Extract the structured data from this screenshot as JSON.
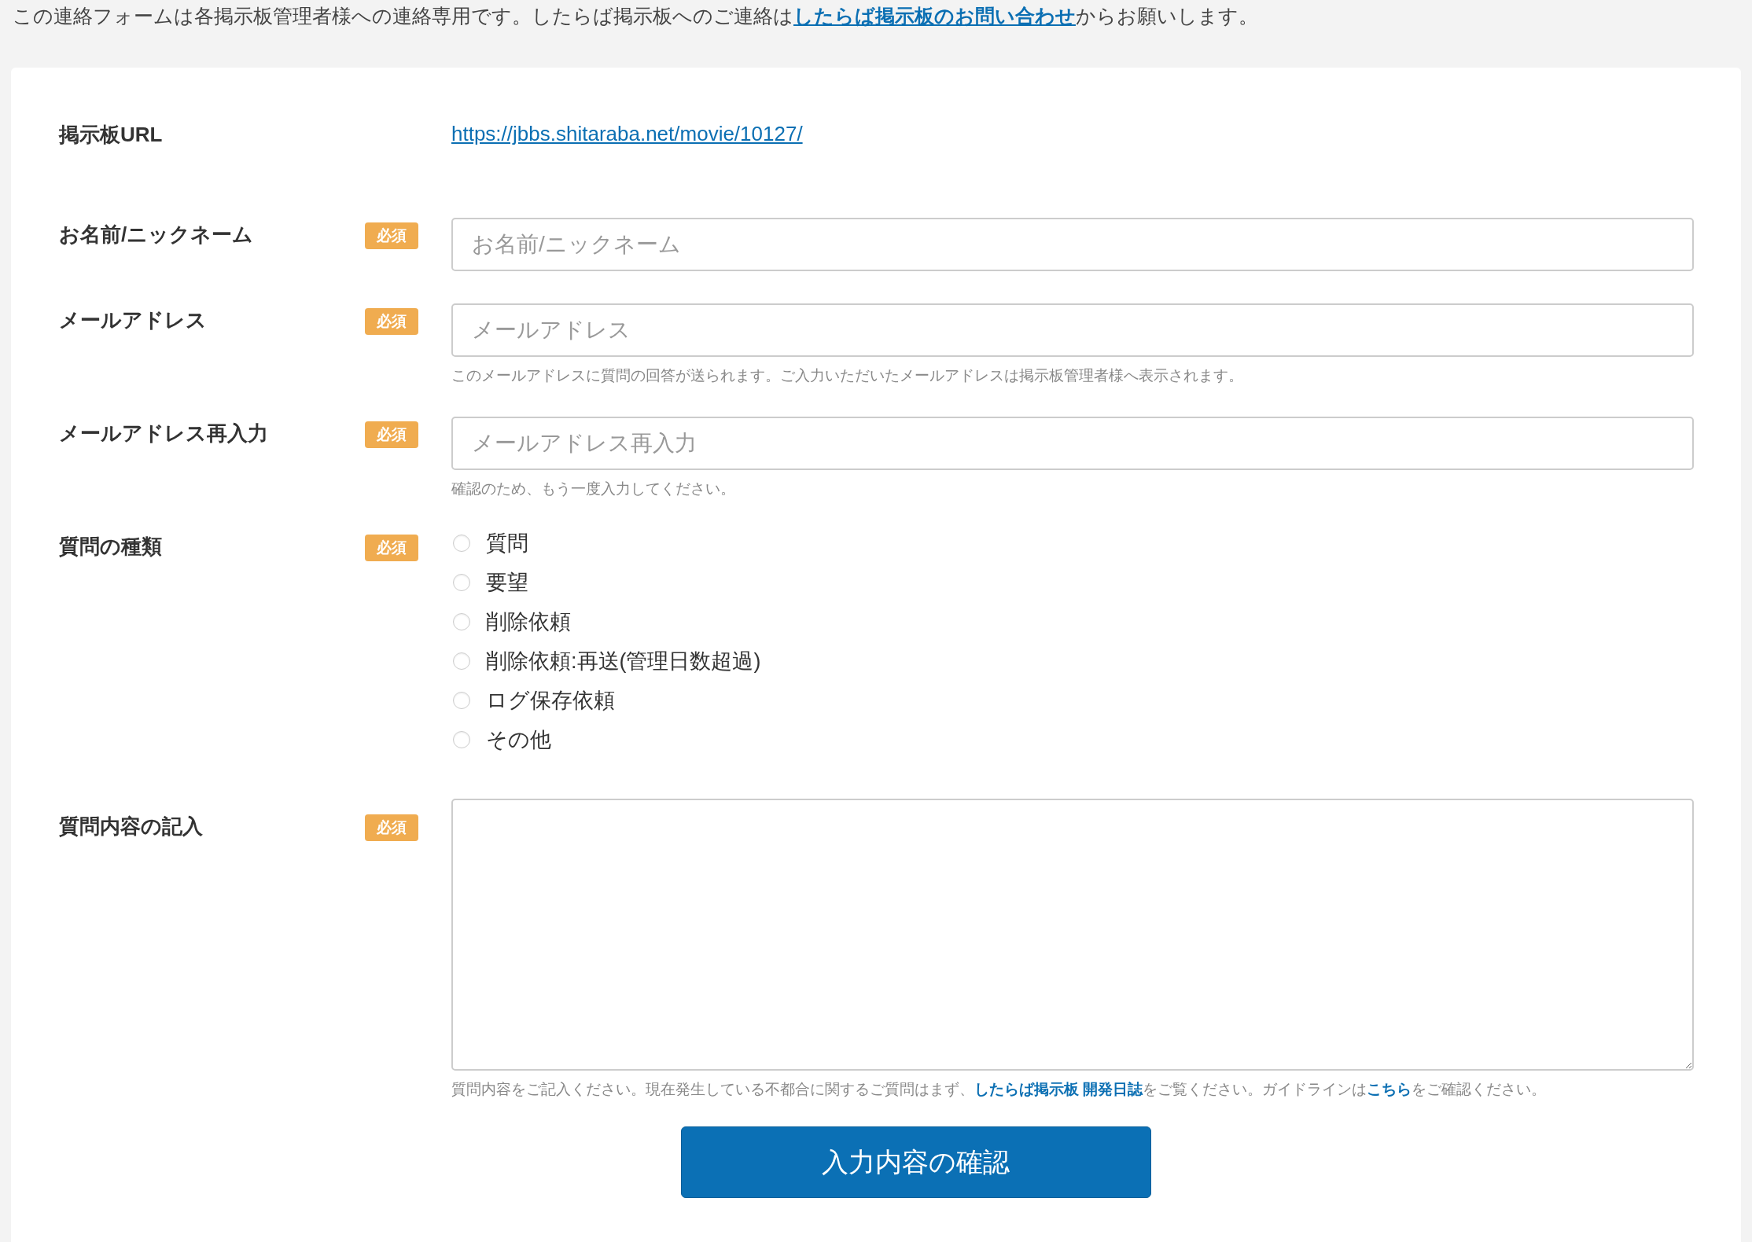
{
  "notice": {
    "before": "この連絡フォームは各掲示板管理者様への連絡専用です。したらば掲示板へのご連絡は",
    "link": "したらば掲示板のお問い合わせ",
    "after": "からお願いします。"
  },
  "fields": [
    {
      "kind": "link",
      "label": "掲示板URL",
      "value": "https://jbbs.shitaraba.net/movie/10127/"
    },
    {
      "kind": "text",
      "label": "お名前/ニックネーム",
      "badge": "必須",
      "placeholder": "お名前/ニックネーム"
    },
    {
      "kind": "text",
      "label": "メールアドレス",
      "badge": "必須",
      "placeholder": "メールアドレス",
      "help": [
        {
          "kind": "text",
          "text": "このメールアドレスに質問の回答が送られます。ご入力いただいたメールアドレスは掲示板管理者様へ表示されます。"
        }
      ]
    },
    {
      "kind": "text",
      "label": "メールアドレス再入力",
      "badge": "必須",
      "placeholder": "メールアドレス再入力",
      "help": [
        {
          "kind": "text",
          "text": "確認のため、もう一度入力してください。"
        }
      ]
    },
    {
      "kind": "radio",
      "label": "質問の種類",
      "badge": "必須",
      "options": [
        {
          "label": "質問",
          "selected": false
        },
        {
          "label": "要望",
          "selected": false
        },
        {
          "label": "削除依頼",
          "selected": false
        },
        {
          "label": "削除依頼:再送(管理日数超過)",
          "selected": false
        },
        {
          "label": "ログ保存依頼",
          "selected": false
        },
        {
          "label": "その他",
          "selected": false
        }
      ]
    },
    {
      "kind": "textarea",
      "label": "質問内容の記入",
      "badge": "必須",
      "help": [
        {
          "kind": "text",
          "text": "質問内容をご記入ください。現在発生している不都合に関するご質問はまず、"
        },
        {
          "kind": "link",
          "text": "したらば掲示板 開発日誌"
        },
        {
          "kind": "text",
          "text": "をご覧ください。ガイドラインは"
        },
        {
          "kind": "link",
          "text": "こちら"
        },
        {
          "kind": "text",
          "text": "をご確認ください。"
        }
      ]
    }
  ],
  "submit": "入力内容の確認"
}
